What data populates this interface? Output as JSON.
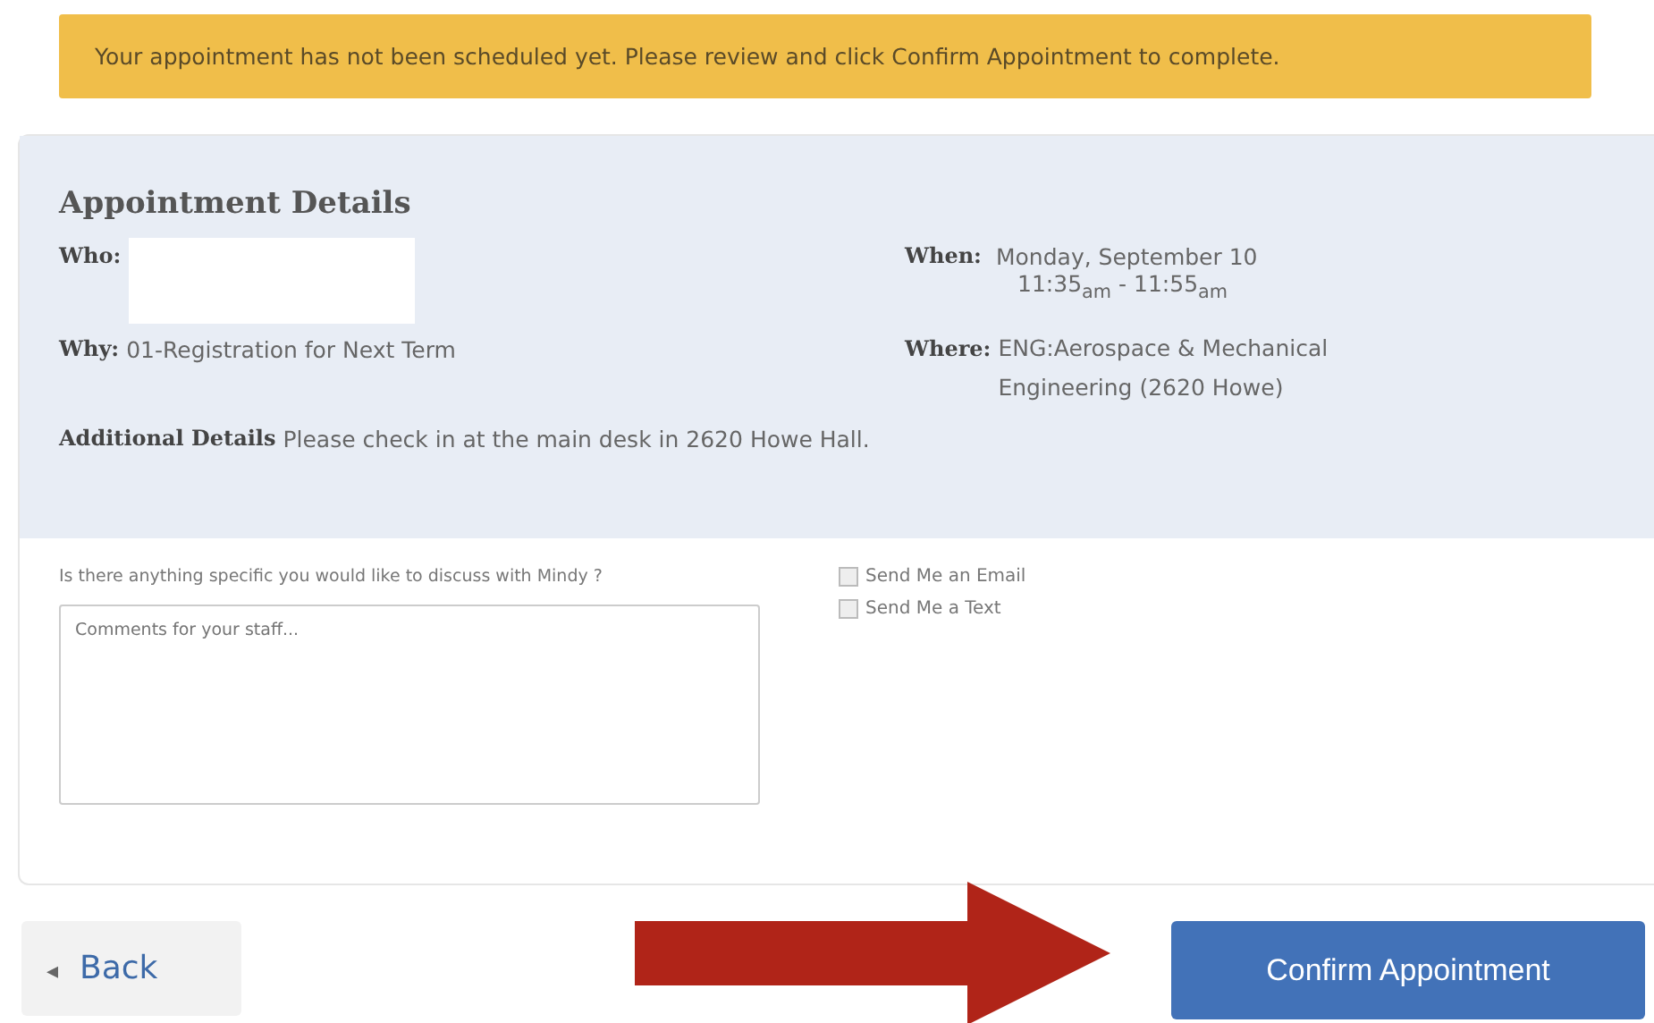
{
  "alert": {
    "message": "Your appointment has not been scheduled yet. Please review and click Confirm Appointment to complete."
  },
  "details": {
    "title": "Appointment Details",
    "who_label": "Who:",
    "when_label": "When:",
    "when_date": "Monday, September 10",
    "when_time": "11:35$_{am}$ - 11:55$_{am}$",
    "why_label": "Why:",
    "why_value": "01-Registration for Next Term",
    "where_label": "Where:",
    "where_value": "ENG:Aerospace & Mechanical Engineering (2620 Howe)",
    "additional_label": "Additional Details",
    "additional_value": "Please check in at the main desk in 2620 Howe Hall."
  },
  "form": {
    "question": "Is there anything specific you would like to discuss with Mindy ?",
    "comments_placeholder": "Comments for your staff...",
    "options": [
      {
        "label": "Send Me an Email",
        "checked": false
      },
      {
        "label": "Send Me a Text",
        "checked": false
      }
    ]
  },
  "buttons": {
    "back": {
      "icon": "◂",
      "label": "Back"
    },
    "confirm": "Confirm Appointment"
  }
}
